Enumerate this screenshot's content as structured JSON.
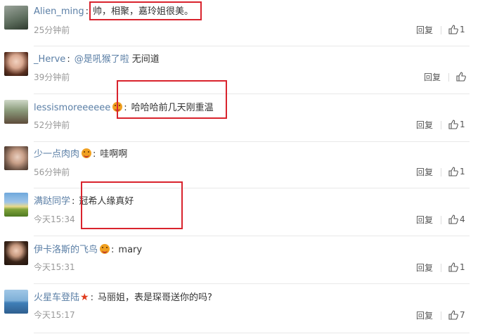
{
  "comments": [
    {
      "user": "Alien_ming",
      "text": "帅，相聚，嘉玲姐很美。",
      "time": "25分钟前",
      "reply": "回复",
      "likes": "1"
    },
    {
      "user": "_Herve",
      "mention": "@是吼猴了啦",
      "text": "无间道",
      "time": "39分钟前",
      "reply": "回复",
      "likes": ""
    },
    {
      "user": "lessismoreeeeee",
      "text": "哈哈哈前几天刚重温",
      "time": "52分钟前",
      "reply": "回复",
      "likes": "1"
    },
    {
      "user": "少一点肉肉",
      "text": "哇啊啊",
      "time": "56分钟前",
      "reply": "回复",
      "likes": "1"
    },
    {
      "user": "满跶同学",
      "text": "冠希人缘真好",
      "time": "今天15:34",
      "reply": "回复",
      "likes": "4"
    },
    {
      "user": "伊卡洛斯的飞鸟",
      "text": "mary",
      "time": "今天15:31",
      "reply": "回复",
      "likes": "1"
    },
    {
      "user": "火星车登陆",
      "text": "马丽姐，表是琛哥送你的吗?",
      "time": "今天15:17",
      "reply": "回复",
      "likes": "7"
    }
  ],
  "colors": {
    "link": "#5b7fa6",
    "highlight": "#d9232d",
    "meta": "#999999"
  },
  "icons": {
    "like": "thumbs-up-icon",
    "badge": "emoji-badge-icon",
    "star": "star-icon"
  }
}
